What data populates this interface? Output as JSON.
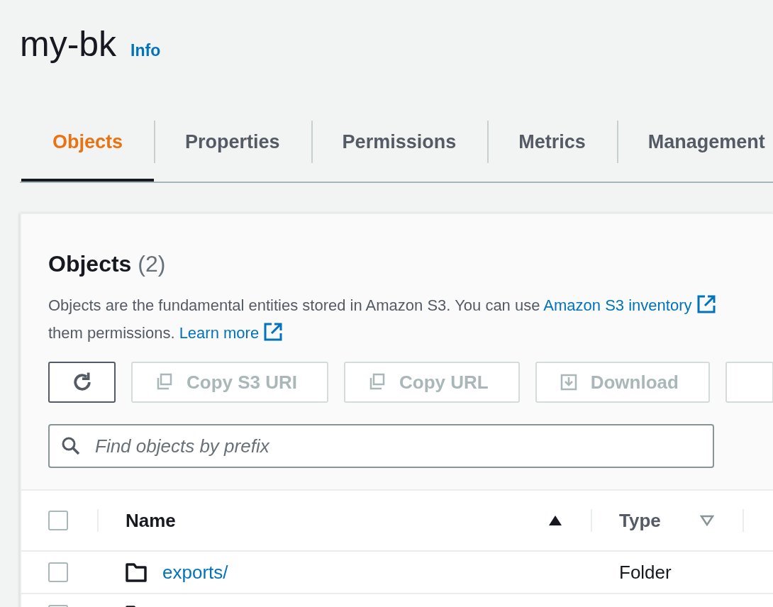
{
  "header": {
    "title": "my-bk",
    "info_link": "Info"
  },
  "tabs": [
    {
      "label": "Objects",
      "selected": true
    },
    {
      "label": "Properties",
      "selected": false
    },
    {
      "label": "Permissions",
      "selected": false
    },
    {
      "label": "Metrics",
      "selected": false
    },
    {
      "label": "Management",
      "selected": false
    }
  ],
  "objects_panel": {
    "title": "Objects",
    "count": "(2)",
    "description_lines": [
      {
        "text": "Objects are the fundamental entities stored in Amazon S3. You can use ",
        "link": "Amazon S3 inventory"
      },
      {
        "text": "them permissions. ",
        "link": "Learn more"
      }
    ],
    "actions": [
      {
        "kind": "refresh",
        "disabled": false
      },
      {
        "kind": "copy",
        "label": "Copy S3 URI",
        "disabled": true
      },
      {
        "kind": "copy",
        "label": "Copy URL",
        "disabled": true
      },
      {
        "kind": "download",
        "label": "Download",
        "disabled": true
      },
      {
        "kind": "more",
        "disabled": true
      }
    ],
    "search": {
      "placeholder": "Find objects by prefix"
    },
    "table": {
      "select_all_checked": false,
      "columns": [
        {
          "label": "Name",
          "sorted": true
        },
        {
          "label": "Type",
          "sorted": false
        },
        {}
      ],
      "rows": [
        {
          "kind": "folder",
          "name": "exports/",
          "type": "Folder",
          "checked": false
        },
        {
          "kind": "folder",
          "checked": false
        }
      ]
    }
  }
}
